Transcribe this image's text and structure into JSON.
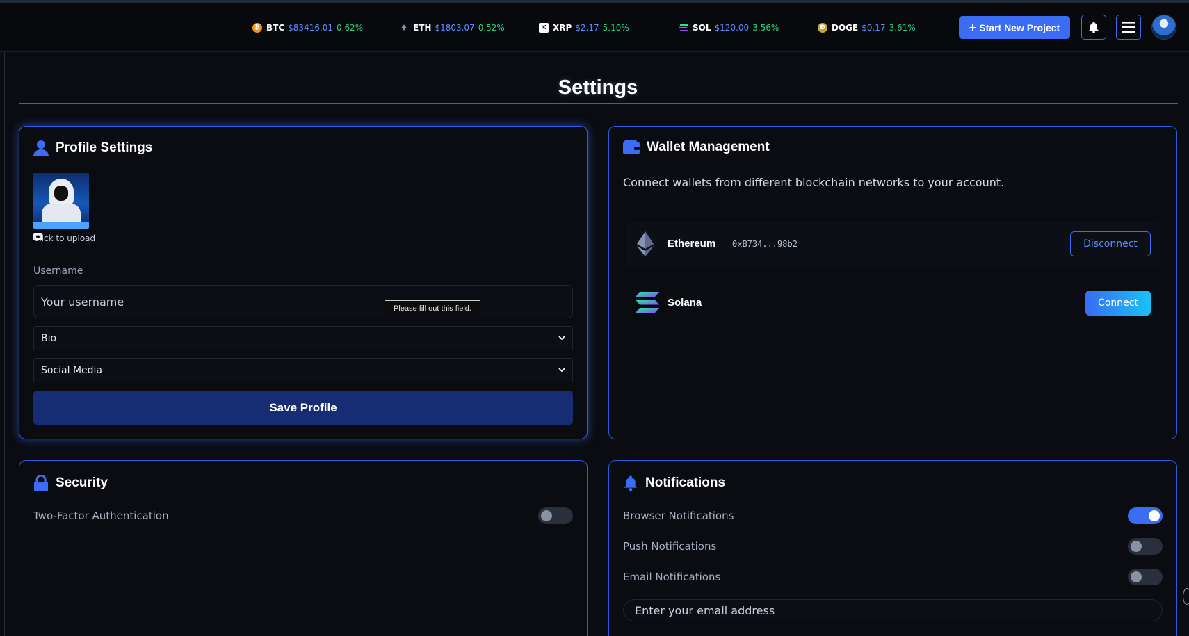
{
  "ticker": [
    {
      "symbol": "BTC",
      "price": "$83416.01",
      "change": "0.62%",
      "icon": "bitcoin-icon",
      "icon_color": "#f7931a"
    },
    {
      "symbol": "ETH",
      "price": "$1803.07",
      "change": "0.52%",
      "icon": "ethereum-icon",
      "icon_color": "#8a92b2"
    },
    {
      "symbol": "XRP",
      "price": "$2.17",
      "change": "5.10%",
      "icon": "xrp-icon",
      "icon_color": "#ffffff"
    },
    {
      "symbol": "SOL",
      "price": "$120.00",
      "change": "3.56%",
      "icon": "solana-icon",
      "icon_color": "#14f195"
    },
    {
      "symbol": "DOGE",
      "price": "$0.17",
      "change": "3.61%",
      "icon": "dogecoin-icon",
      "icon_color": "#c2a633"
    }
  ],
  "header": {
    "start_project": "Start New Project"
  },
  "page": {
    "title": "Settings"
  },
  "profile": {
    "title": "Profile Settings",
    "upload_text": "Click to upload",
    "username_label": "Username",
    "username_placeholder": "Your username",
    "bio_label": "Bio",
    "social_label": "Social Media",
    "save_label": "Save Profile",
    "tooltip": "Please fill out this field."
  },
  "wallet": {
    "title": "Wallet Management",
    "description": "Connect wallets from different blockchain networks to your account.",
    "items": [
      {
        "name": "Ethereum",
        "address": "0xB734...98b2",
        "action": "Disconnect"
      },
      {
        "name": "Solana",
        "address": "",
        "action": "Connect"
      }
    ]
  },
  "security": {
    "title": "Security",
    "two_factor_label": "Two-Factor Authentication",
    "two_factor_on": false
  },
  "notifications": {
    "title": "Notifications",
    "items": [
      {
        "label": "Browser Notifications",
        "on": true
      },
      {
        "label": "Push Notifications",
        "on": false
      },
      {
        "label": "Email Notifications",
        "on": false
      }
    ],
    "email_placeholder": "Enter your email address"
  },
  "colors": {
    "accent": "#3a6cf4",
    "positive": "#28d17c",
    "background": "#0a0c11"
  }
}
